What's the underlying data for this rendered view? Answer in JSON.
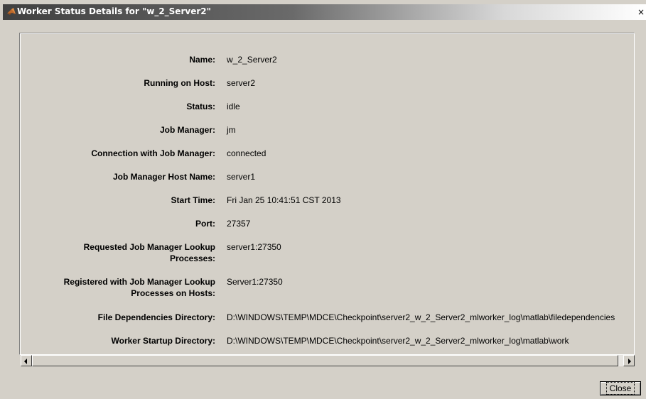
{
  "window": {
    "title": "Worker Status Details for \"w_2_Server2\"",
    "close_glyph": "×"
  },
  "details": [
    {
      "label": "Name:",
      "value": "w_2_Server2"
    },
    {
      "label": "Running on Host:",
      "value": "server2"
    },
    {
      "label": "Status:",
      "value": "idle"
    },
    {
      "label": "Job Manager:",
      "value": "jm"
    },
    {
      "label": "Connection with Job Manager:",
      "value": "connected"
    },
    {
      "label": "Job Manager Host Name:",
      "value": "server1"
    },
    {
      "label": "Start Time:",
      "value": "Fri Jan 25 10:41:51 CST 2013"
    },
    {
      "label": "Port:",
      "value": "27357"
    },
    {
      "label_line1": "Requested Job Manager Lookup",
      "label_line2": "Processes:",
      "value": "server1:27350"
    },
    {
      "label_line1": "Registered with Job Manager Lookup",
      "label_line2": "Processes on Hosts:",
      "value": "Server1:27350"
    },
    {
      "label": "File Dependencies Directory:",
      "value": "D:\\WINDOWS\\TEMP\\MDCE\\Checkpoint\\server2_w_2_Server2_mlworker_log\\matlab\\filedependencies"
    },
    {
      "label": "Worker Startup Directory:",
      "value": "D:\\WINDOWS\\TEMP\\MDCE\\Checkpoint\\server2_w_2_Server2_mlworker_log\\matlab\\work"
    }
  ],
  "buttons": {
    "close_label": "Close"
  },
  "icons": {
    "title": "matlab-logo-icon",
    "scroll_left": "arrow-left-icon",
    "scroll_right": "arrow-right-icon"
  }
}
